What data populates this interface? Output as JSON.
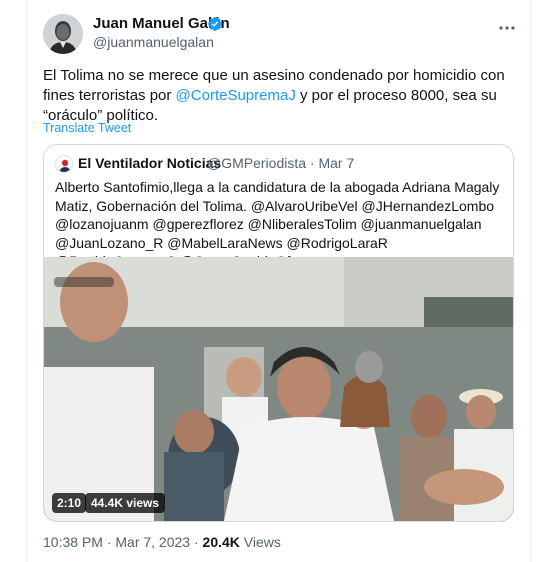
{
  "author": {
    "name": "Juan Manuel Galán",
    "handle": "@juanmanuelgalan",
    "verified_color": "#1d9bf0"
  },
  "tweet": {
    "text_before": "El Tolima no se merece que un asesino condenado por homicidio con fines terroristas por ",
    "mention": "@CorteSupremaJ",
    "text_after": " y por el proceso 8000, sea su “oráculo” político.",
    "translate_label": "Translate Tweet"
  },
  "quote": {
    "name": "El Ventilador Noticias",
    "handle_date": "@GMPeriodista · Mar 7",
    "text": "Alberto Santofimio,llega a la candidatura de la abogada Adriana Magaly Matiz, Gobernación del Tolima. @AlvaroUribeVel @JHernandezLombo @lozanojuanm @gperezflorez @NliberalesTolim @juanmanuelgalan @JuanLozano_R @MabelLaraNews @RodrigoLaraR @PartidoConservC @CesarGaviriaOf",
    "video_duration": "2:10",
    "video_views": "44.4K views"
  },
  "meta": {
    "time_date": "10:38 PM · Mar 7, 2023 · ",
    "views_count": "20.4K",
    "views_label": " Views"
  },
  "icons": [
    "more-icon",
    "verified-badge-icon"
  ],
  "colors": {
    "link": "#1d9bf0",
    "text": "#0f1419",
    "secondary": "#536471",
    "border": "#cfd9de"
  }
}
